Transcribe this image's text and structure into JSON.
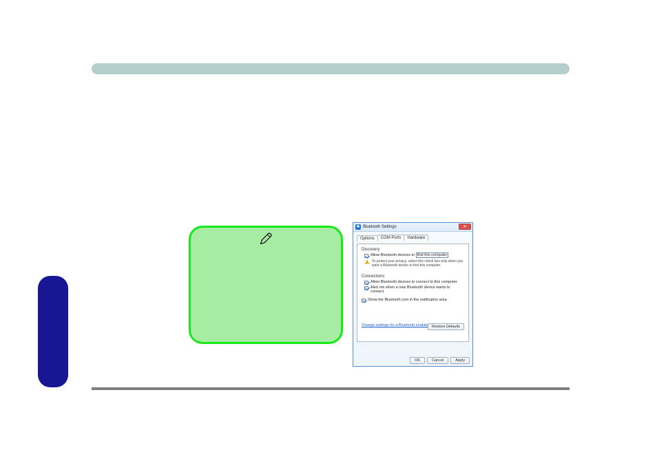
{
  "bt": {
    "title": "Bluetooth Settings",
    "tabs": {
      "options": "Options",
      "com": "COM Ports",
      "hw": "Hardware"
    },
    "discovery": {
      "label": "Discovery",
      "allow_pre": "Allow Bluetooth devices to",
      "allow_boxed": "find this computer",
      "warn": "To protect your privacy, select this check box only when you want a Bluetooth device to find this computer."
    },
    "connections": {
      "label": "Connections",
      "allow": "Allow Bluetooth devices to connect to this computer",
      "alert": "Alert me when a new Bluetooth device wants to connect"
    },
    "notif": "Show the Bluetooth icon in the notification area",
    "link": "Change settings for a Bluetooth enabled device.",
    "buttons": {
      "restore": "Restore Defaults",
      "ok": "OK",
      "cancel": "Cancel",
      "apply": "Apply"
    }
  }
}
